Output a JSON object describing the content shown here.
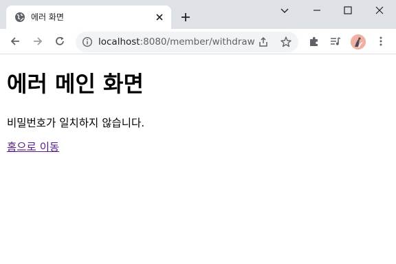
{
  "browser": {
    "tab": {
      "title": "에러 화면"
    },
    "omnibox": {
      "url_host": "localhost",
      "url_path": ":8080/member/withdraw"
    }
  },
  "page": {
    "heading": "에러 메인 화면",
    "message": "비밀번호가 일치하지 않습니다.",
    "home_link": "홈으로 이동"
  }
}
